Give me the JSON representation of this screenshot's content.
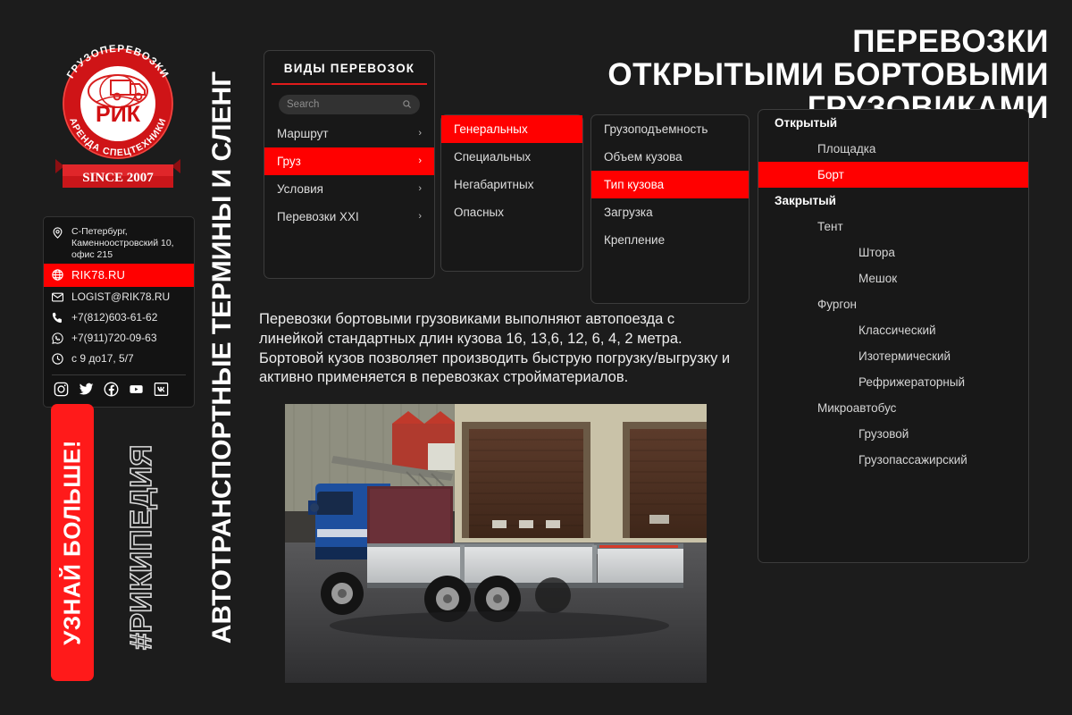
{
  "heading": {
    "line1": "ПЕРЕВОЗКИ",
    "line2": "ОТКРЫТЫМИ БОРТОВЫМИ ГРУЗОВИКАМИ"
  },
  "vertical_title": "АВТОТРАНСПОРТНЫЕ ТЕРМИНЫ И СЛЕНГ",
  "cta": {
    "label": "УЗНАЙ БОЛЬШЕ!"
  },
  "hashtag": {
    "label": "#РИКИПЕДИЯ"
  },
  "logo": {
    "top_arc": "ГРУЗОПЕРЕВОЗКИ",
    "bottom_arc": "АРЕНДА СПЕЦТЕХНИКИ",
    "center": "РИК",
    "ribbon": "SINCE 2007"
  },
  "contact": {
    "address": "С-Петербург, Каменноостровский 10, офис 215",
    "website": "RIK78.RU",
    "email": "LOGIST@RIK78.RU",
    "phone": "+7(812)603-61-62",
    "whatsapp": "+7(911)720-09-63",
    "hours": "с 9 до17,  5/7",
    "social": [
      "instagram-icon",
      "twitter-icon",
      "facebook-icon",
      "youtube-icon",
      "vk-icon"
    ]
  },
  "panel_types": {
    "title": "ВИДЫ ПЕРЕВОЗОК",
    "search_placeholder": "Search",
    "search_value": "",
    "items": [
      {
        "label": "Маршрут",
        "active": false,
        "chevron": "›"
      },
      {
        "label": "Груз",
        "active": true,
        "chevron": "›"
      },
      {
        "label": "Условия",
        "active": false,
        "chevron": "›"
      },
      {
        "label": "Перевозки XXI",
        "active": false,
        "chevron": "›"
      }
    ]
  },
  "panel_cargo": {
    "items": [
      {
        "label": "Генеральных",
        "active": true
      },
      {
        "label": "Специальных",
        "active": false
      },
      {
        "label": "Негабаритных",
        "active": false
      },
      {
        "label": "Опасных",
        "active": false
      }
    ]
  },
  "panel_conditions": {
    "items": [
      {
        "label": "Грузоподъемность",
        "active": false
      },
      {
        "label": "Объем кузова",
        "active": false
      },
      {
        "label": "Тип кузова",
        "active": true
      },
      {
        "label": "Загрузка",
        "active": false
      },
      {
        "label": "Крепление",
        "active": false
      }
    ]
  },
  "panel_bodytypes": {
    "items": [
      {
        "label": "Открытый",
        "level": 0,
        "active": false
      },
      {
        "label": "Площадка",
        "level": 1,
        "active": false
      },
      {
        "label": "Борт",
        "level": 1,
        "active": true
      },
      {
        "label": "Закрытый",
        "level": 0,
        "active": false
      },
      {
        "label": "Тент",
        "level": 1,
        "active": false
      },
      {
        "label": "Штора",
        "level": 2,
        "active": false
      },
      {
        "label": "Мешок",
        "level": 2,
        "active": false
      },
      {
        "label": "Фургон",
        "level": 1,
        "active": false
      },
      {
        "label": "Классический",
        "level": 2,
        "active": false
      },
      {
        "label": "Изотермический",
        "level": 2,
        "active": false
      },
      {
        "label": "Рефрижераторный",
        "level": 2,
        "active": false
      },
      {
        "label": "Микроавтобус",
        "level": 1,
        "active": false
      },
      {
        "label": "Грузовой",
        "level": 2,
        "active": false
      },
      {
        "label": "Грузопассажирский",
        "level": 2,
        "active": false
      }
    ]
  },
  "description": "Перевозки бортовыми грузовиками выполняют автопоезда с линейкой стандартных длин кузова 16, 13,6, 12, 6, 4, 2 метра. Бортовой кузов позволяет производить быструю погрузку/выгрузку и активно применяется в перевозках стройматериалов.",
  "photo": {
    "name": "flatbed-truck-photo",
    "alt": "Синий бортовой грузовик у складских ворот"
  },
  "colors": {
    "background": "#1c1c1c",
    "panel": "#181818",
    "accent_red": "#ff0000",
    "cta_red": "#ff1a1a",
    "text": "#e8e8e8"
  }
}
